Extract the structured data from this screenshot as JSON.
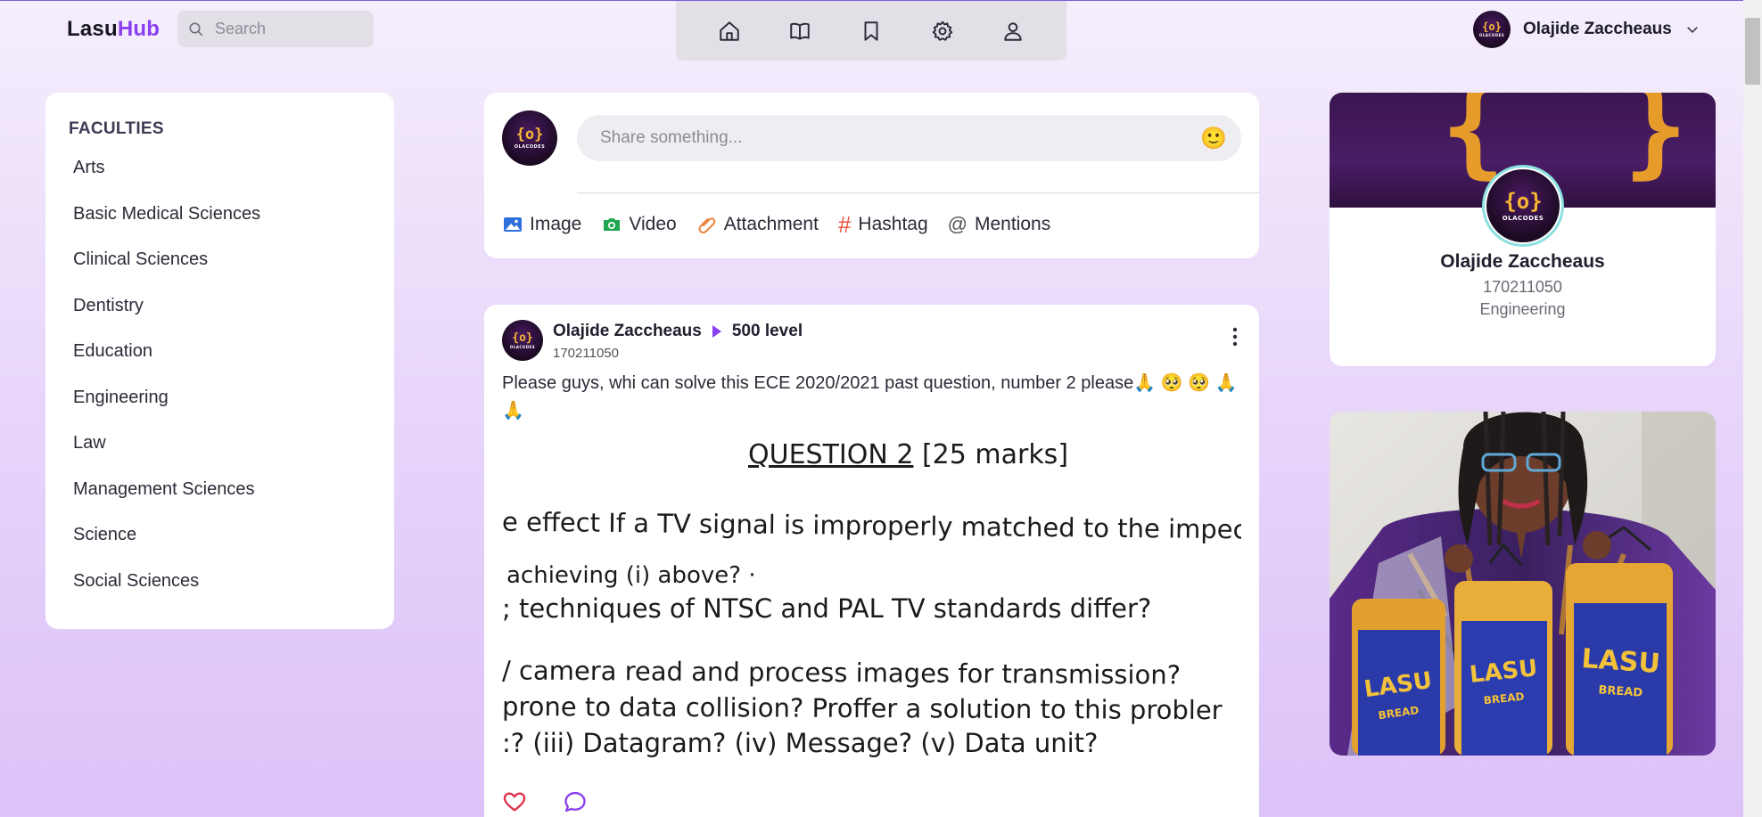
{
  "header": {
    "logo": {
      "part1": "Lasu",
      "part2": "Hub"
    },
    "search": {
      "placeholder": "Search"
    },
    "nav": [
      {
        "name": "home",
        "icon": "home-icon"
      },
      {
        "name": "book",
        "icon": "book-open-icon"
      },
      {
        "name": "bookmark",
        "icon": "bookmark-icon"
      },
      {
        "name": "settings",
        "icon": "gear-icon"
      },
      {
        "name": "profile",
        "icon": "user-icon"
      }
    ],
    "user": {
      "name": "Olajide Zaccheaus",
      "avatar_text": "{o}",
      "avatar_brand": "OLACODES"
    }
  },
  "faculties": {
    "title": "FACULTIES",
    "items": [
      "Arts",
      "Basic Medical Sciences",
      "Clinical Sciences",
      "Dentistry",
      "Education",
      "Engineering",
      "Law",
      "Management Sciences",
      "Science",
      "Social Sciences"
    ]
  },
  "composer": {
    "placeholder": "Share something...",
    "emoji": "🙂",
    "actions": [
      {
        "label": "Image",
        "icon": "image-icon"
      },
      {
        "label": "Video",
        "icon": "camera-icon"
      },
      {
        "label": "Attachment",
        "icon": "paperclip-icon"
      },
      {
        "label": "Hashtag",
        "icon": "hashtag-icon",
        "symbol": "#"
      },
      {
        "label": "Mentions",
        "icon": "at-icon",
        "symbol": "@"
      }
    ]
  },
  "post": {
    "author": "Olajide Zaccheaus",
    "level": "500 level",
    "matric": "170211050",
    "text": "Please guys, whi can solve this ECE 2020/2021 past question, number 2 please🙏 🥺 🥺 🙏 🙏",
    "image_lines": {
      "title_q": "QUESTION 2",
      "title_marks": " [25 marks]",
      "l1": "e effect If a TV signal is improperly matched to the impec",
      "l2": "achieving (i) above? ·",
      "l3": "; techniques of NTSC and PAL TV standards differ?",
      "l4": "/ camera read and process images for transmission?",
      "l5": " prone to data collision? Proffer a solution to this probler",
      "l6": ":? (iii) Datagram? (iv) Message? (v) Data unit?"
    },
    "reactions": [
      {
        "icon": "heart-icon"
      },
      {
        "icon": "comment-icon"
      }
    ]
  },
  "profile_card": {
    "name": "Olajide Zaccheaus",
    "matric": "170211050",
    "department": "Engineering",
    "cover_text": "{ }"
  },
  "ad_photo": {
    "bag_label": "LASU",
    "bag_sub": "BREAD"
  },
  "colors": {
    "brand": "#8a3ff0",
    "accent_orange": "#f7b733"
  }
}
